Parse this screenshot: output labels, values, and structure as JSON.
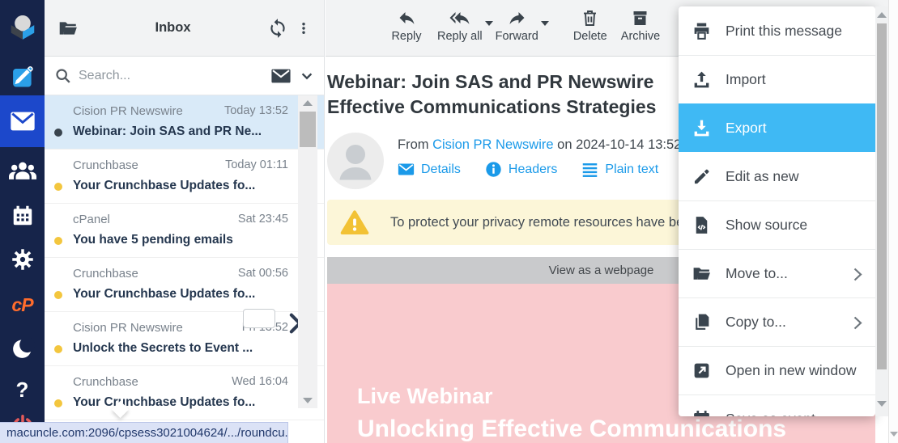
{
  "colors": {
    "sidebar_bg": "#16244a",
    "sidebar_selected_bg": "#1c48cb",
    "accent_blue": "#2b9fe8",
    "link_blue": "#1b9ae9",
    "export_highlight": "#3fb9f4",
    "unread_dot": "#f3c63e",
    "selected_row_bg": "#d9eaf8",
    "warning_bg": "#fcf6d8",
    "warning_icon": "#f2c235",
    "banner_pink": "#f9cbce",
    "cpanel_orange": "#ff6c2c",
    "logout_red": "#e25a5a",
    "toolbar_bg": "#f2f3f4"
  },
  "sidebar": {
    "items": [
      {
        "icon": "roundcube-logo-icon"
      },
      {
        "icon": "compose-icon"
      },
      {
        "icon": "mail-icon",
        "selected": true
      },
      {
        "icon": "contacts-icon"
      },
      {
        "icon": "calendar-icon"
      },
      {
        "icon": "settings-gear-icon"
      },
      {
        "icon": "cpanel-icon",
        "label": "cP"
      },
      {
        "icon": "dark-mode-moon-icon"
      },
      {
        "icon": "help-icon",
        "label": "?"
      },
      {
        "icon": "logout-power-icon"
      }
    ],
    "cpanel_label": "cP",
    "help_label": "?"
  },
  "list": {
    "title": "Inbox",
    "search_placeholder": "Search...",
    "emails": [
      {
        "sender": "Cision PR Newswire",
        "date": "Today 13:52",
        "subject": "Webinar: Join SAS and PR Ne...",
        "selected": true,
        "dot": "read"
      },
      {
        "sender": "Crunchbase",
        "date": "Today 01:11",
        "subject": "Your Crunchbase Updates fo...",
        "dot": "unread"
      },
      {
        "sender": "cPanel",
        "date": "Sat 23:45",
        "subject": "You have 5 pending emails",
        "dot": "unread"
      },
      {
        "sender": "Crunchbase",
        "date": "Sat 00:56",
        "subject": "Your Crunchbase Updates fo...",
        "dot": "unread"
      },
      {
        "sender": "Cision PR Newswire",
        "date": "Fri 13:52",
        "subject": "Unlock the Secrets to Event ...",
        "dot": "unread"
      },
      {
        "sender": "Crunchbase",
        "date": "Wed 16:04",
        "subject": "Your Crunchbase Updates fo...",
        "dot": "unread"
      }
    ]
  },
  "toolbar": {
    "buttons": [
      {
        "label": "Reply",
        "icon": "reply-icon",
        "caret": false
      },
      {
        "label": "Reply all",
        "icon": "reply-all-icon",
        "caret": true
      },
      {
        "label": "Forward",
        "icon": "forward-icon",
        "caret": true
      },
      {
        "label": "Delete",
        "icon": "delete-trash-icon",
        "caret": false
      },
      {
        "label": "Archive",
        "icon": "archive-icon",
        "caret": false
      }
    ]
  },
  "message": {
    "subject_line1": "Webinar: Join SAS and PR Newswire",
    "subject_line2": "Effective Communications Strategies",
    "from_prefix": "From",
    "from_name": "Cision PR Newswire",
    "date_text": "on 2024-10-14 13:52",
    "links": [
      {
        "label": "Details",
        "icon": "envelope-icon"
      },
      {
        "label": "Headers",
        "icon": "info-circle-icon"
      },
      {
        "label": "Plain text",
        "icon": "plain-text-lines-icon"
      }
    ],
    "privacy_warning": "To protect your privacy remote resources have been blocked.",
    "view_webpage": "View as a webpage",
    "banner": {
      "line1": "Live Webinar",
      "line2": "Unlocking Effective Communications"
    }
  },
  "context_menu": {
    "items": [
      {
        "label": "Print this message",
        "icon": "printer-icon"
      },
      {
        "label": "Import",
        "icon": "import-upload-icon"
      },
      {
        "label": "Export",
        "icon": "export-download-icon",
        "selected": true
      },
      {
        "label": "Edit as new",
        "icon": "pencil-icon"
      },
      {
        "label": "Show source",
        "icon": "source-code-file-icon"
      },
      {
        "label": "Move to...",
        "icon": "folder-open-icon",
        "submenu": true
      },
      {
        "label": "Copy to...",
        "icon": "copy-pages-icon",
        "submenu": true
      },
      {
        "label": "Open in new window",
        "icon": "open-new-window-icon"
      },
      {
        "label": "Save as event",
        "icon": "calendar-event-icon"
      }
    ]
  },
  "statusbar": {
    "url": "macuncle.com:2096/cpsess3021004624/.../roundcu..."
  }
}
